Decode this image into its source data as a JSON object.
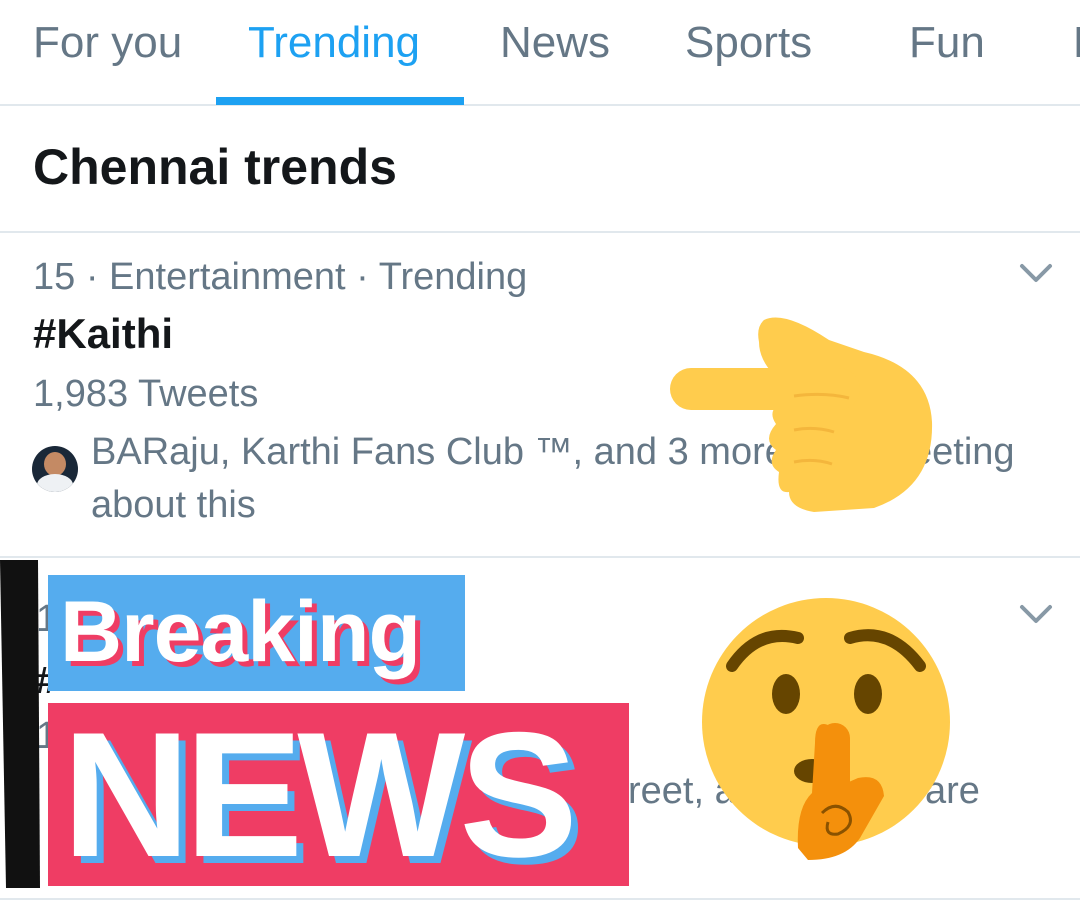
{
  "tabs": [
    {
      "label": "For you"
    },
    {
      "label": "Trending"
    },
    {
      "label": "News"
    },
    {
      "label": "Sports"
    },
    {
      "label": "Fun"
    },
    {
      "label": "E"
    }
  ],
  "active_tab": "Trending",
  "section_title": "Chennai trends",
  "trend1": {
    "meta": "15 · Entertainment · Trending",
    "name": "#Kaithi",
    "count": "1,983 Tweets",
    "context_line1": "BARaju, Karthi Fans Club ™, and 3 more",
    "context_line1_tail": "eeting",
    "context_line2": "about this"
  },
  "trend2_fragments": {
    "rank_digit": "1",
    "hash": "#",
    "count_digit": "1",
    "context_fragment_a": "reet, a",
    "context_fragment_b": "are"
  },
  "overlay": {
    "breaking": "Breaking",
    "news": "NEWS"
  },
  "icons": [
    "chevron-down-icon",
    "pointing-hand-icon",
    "shushing-face-icon"
  ],
  "colors": {
    "accent": "#1da1f2",
    "tab_inactive": "#657786",
    "text_primary": "#14171a",
    "divider": "#e1e8ed",
    "breaking_blue": "#55acee",
    "news_red": "#ef3d64",
    "emoji_yellow": "#ffcc4d"
  }
}
